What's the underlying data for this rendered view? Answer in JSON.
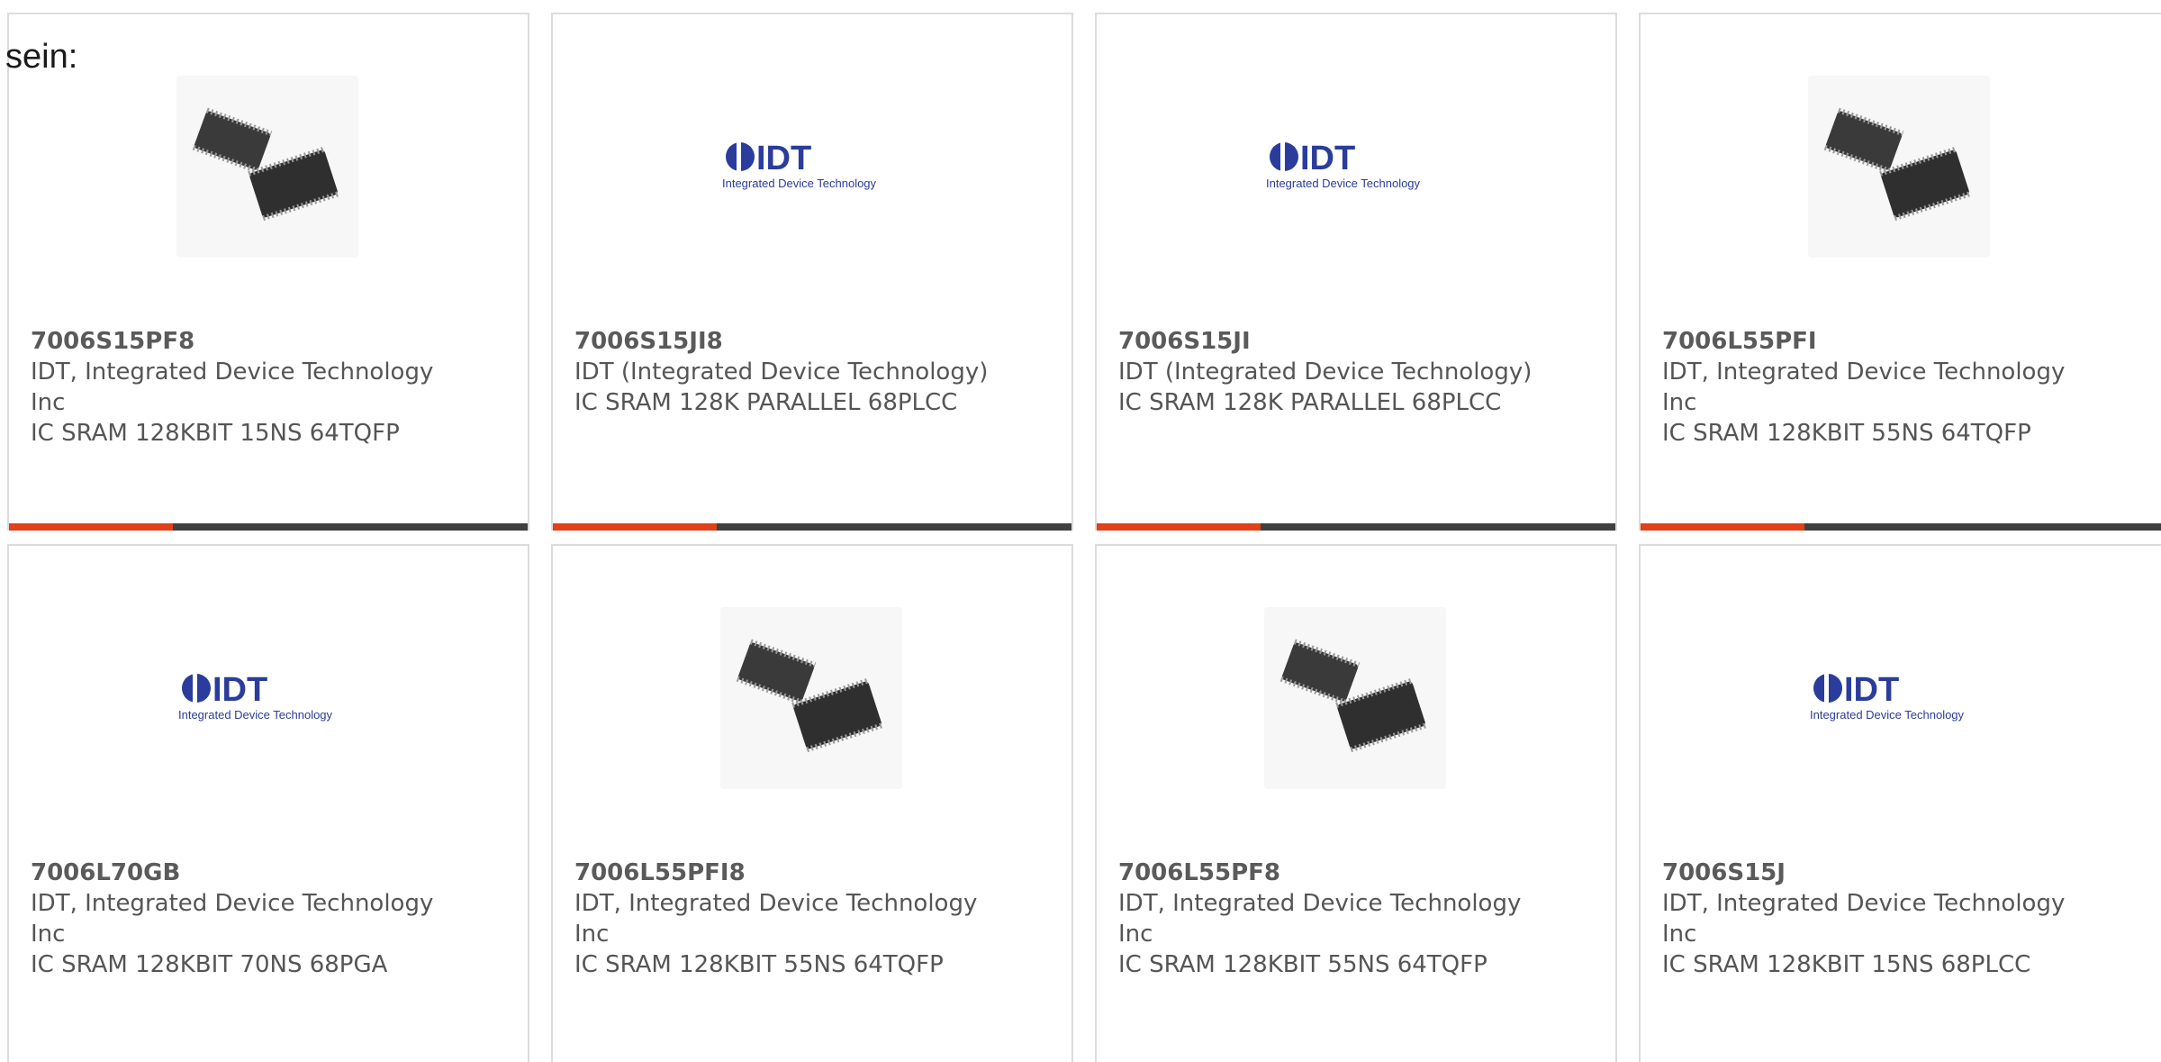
{
  "intro_text": "sein:",
  "colors": {
    "accent": "#e0401a",
    "bar": "#404040",
    "idt_blue": "#2a3c9c"
  },
  "logo": {
    "brand": "IDT",
    "tagline": "Integrated Device Technology"
  },
  "products": [
    {
      "part_number": "7006S15PF8",
      "manufacturer": "IDT, Integrated Device Technology Inc",
      "description": "IC SRAM 128KBIT 15NS 64TQFP",
      "image": "chip-photo"
    },
    {
      "part_number": "7006S15JI8",
      "manufacturer": "IDT (Integrated Device Technology)",
      "description": "IC SRAM 128K PARALLEL 68PLCC",
      "image": "idt-logo"
    },
    {
      "part_number": "7006S15JI",
      "manufacturer": "IDT (Integrated Device Technology)",
      "description": "IC SRAM 128K PARALLEL 68PLCC",
      "image": "idt-logo"
    },
    {
      "part_number": "7006L55PFI",
      "manufacturer": "IDT, Integrated Device Technology Inc",
      "description": "IC SRAM 128KBIT 55NS 64TQFP",
      "image": "chip-photo"
    },
    {
      "part_number": "7006L70GB",
      "manufacturer": "IDT, Integrated Device Technology Inc",
      "description": "IC SRAM 128KBIT 70NS 68PGA",
      "image": "idt-logo"
    },
    {
      "part_number": "7006L55PFI8",
      "manufacturer": "IDT, Integrated Device Technology Inc",
      "description": "IC SRAM 128KBIT 55NS 64TQFP",
      "image": "chip-photo"
    },
    {
      "part_number": "7006L55PF8",
      "manufacturer": "IDT, Integrated Device Technology Inc",
      "description": "IC SRAM 128KBIT 55NS 64TQFP",
      "image": "chip-photo"
    },
    {
      "part_number": "7006S15J",
      "manufacturer": "IDT, Integrated Device Technology Inc",
      "description": "IC SRAM 128KBIT 15NS 68PLCC",
      "image": "idt-logo"
    }
  ]
}
